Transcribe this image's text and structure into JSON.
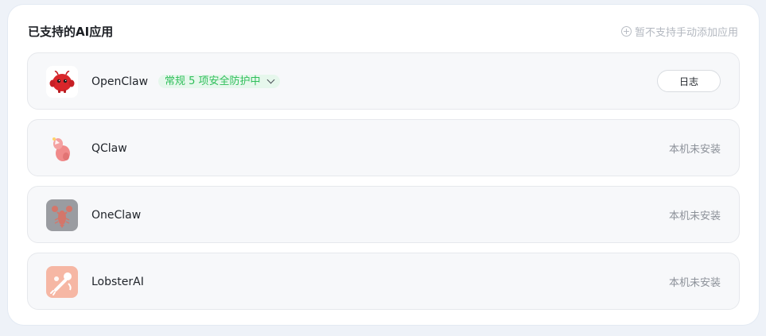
{
  "header": {
    "title": "已支持的AI应用",
    "add_hint_icon": "plus-circle-icon",
    "add_hint_label": "暂不支持手动添加应用"
  },
  "apps": [
    {
      "name": "OpenClaw",
      "icon": "openclaw-red-mascot-icon",
      "status_label": "常规 5 项安全防护中",
      "status_color": "#2fbf5a",
      "status_bg": "#e6f7ec",
      "action_label": "日志"
    },
    {
      "name": "QClaw",
      "icon": "qclaw-pink-claw-icon",
      "install_state": "本机未安装"
    },
    {
      "name": "OneClaw",
      "icon": "oneclaw-lobster-icon",
      "install_state": "本机未安装"
    },
    {
      "name": "LobsterAI",
      "icon": "lobsterai-lobster-icon",
      "install_state": "本机未安装"
    }
  ]
}
